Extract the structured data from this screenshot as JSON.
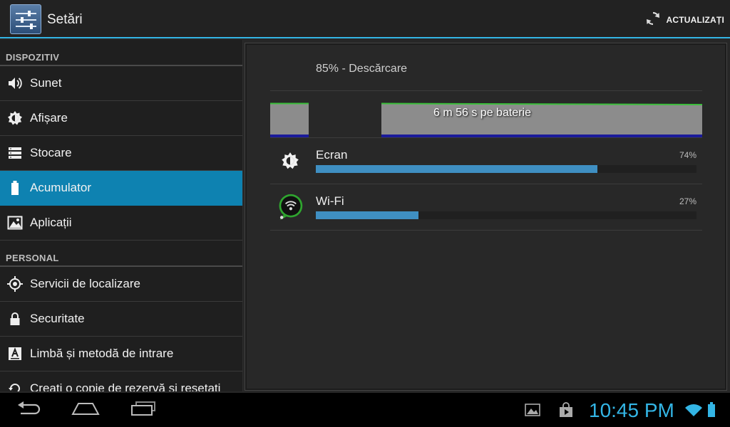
{
  "actionbar": {
    "title": "Setări",
    "refresh_label": "ACTUALIZAȚI",
    "app_icon": "settings-sliders-icon",
    "refresh_icon": "refresh-icon"
  },
  "sidebar": {
    "sections": [
      {
        "header": "DISPOZITIV",
        "items": [
          {
            "label": "Sunet",
            "icon": "speaker-icon"
          },
          {
            "label": "Afișare",
            "icon": "brightness-icon"
          },
          {
            "label": "Stocare",
            "icon": "storage-icon"
          },
          {
            "label": "Acumulator",
            "icon": "battery-icon",
            "selected": true
          },
          {
            "label": "Aplicații",
            "icon": "apps-icon"
          }
        ]
      },
      {
        "header": "PERSONAL",
        "items": [
          {
            "label": "Servicii de localizare",
            "icon": "location-icon"
          },
          {
            "label": "Securitate",
            "icon": "lock-icon"
          },
          {
            "label": "Limbă și metodă de intrare",
            "icon": "keyboard-icon"
          },
          {
            "label": "Creați o copie de rezervă și resetați",
            "icon": "backup-icon"
          }
        ]
      }
    ]
  },
  "battery": {
    "status": "85% - Descărcare",
    "graph_label": "6 m 56 s pe baterie",
    "usage": [
      {
        "name": "Ecran",
        "percent_label": "74%",
        "percent": 74,
        "icon": "brightness-icon"
      },
      {
        "name": "Wi-Fi",
        "percent_label": "27%",
        "percent": 27,
        "icon": "wifi-icon"
      }
    ]
  },
  "navbar": {
    "time": "10:45 PM",
    "buttons": [
      "back-button",
      "home-button",
      "recent-apps-button"
    ],
    "status_icons": [
      "gallery-icon",
      "shopping-bag-icon",
      "wifi-icon",
      "battery-icon"
    ]
  },
  "colors": {
    "accent": "#33b5e5",
    "selected": "#0e82b1",
    "usage_bar": "#3f8fc2",
    "graph_green": "#3bbf3b",
    "graph_blue": "#1b1b9a"
  }
}
